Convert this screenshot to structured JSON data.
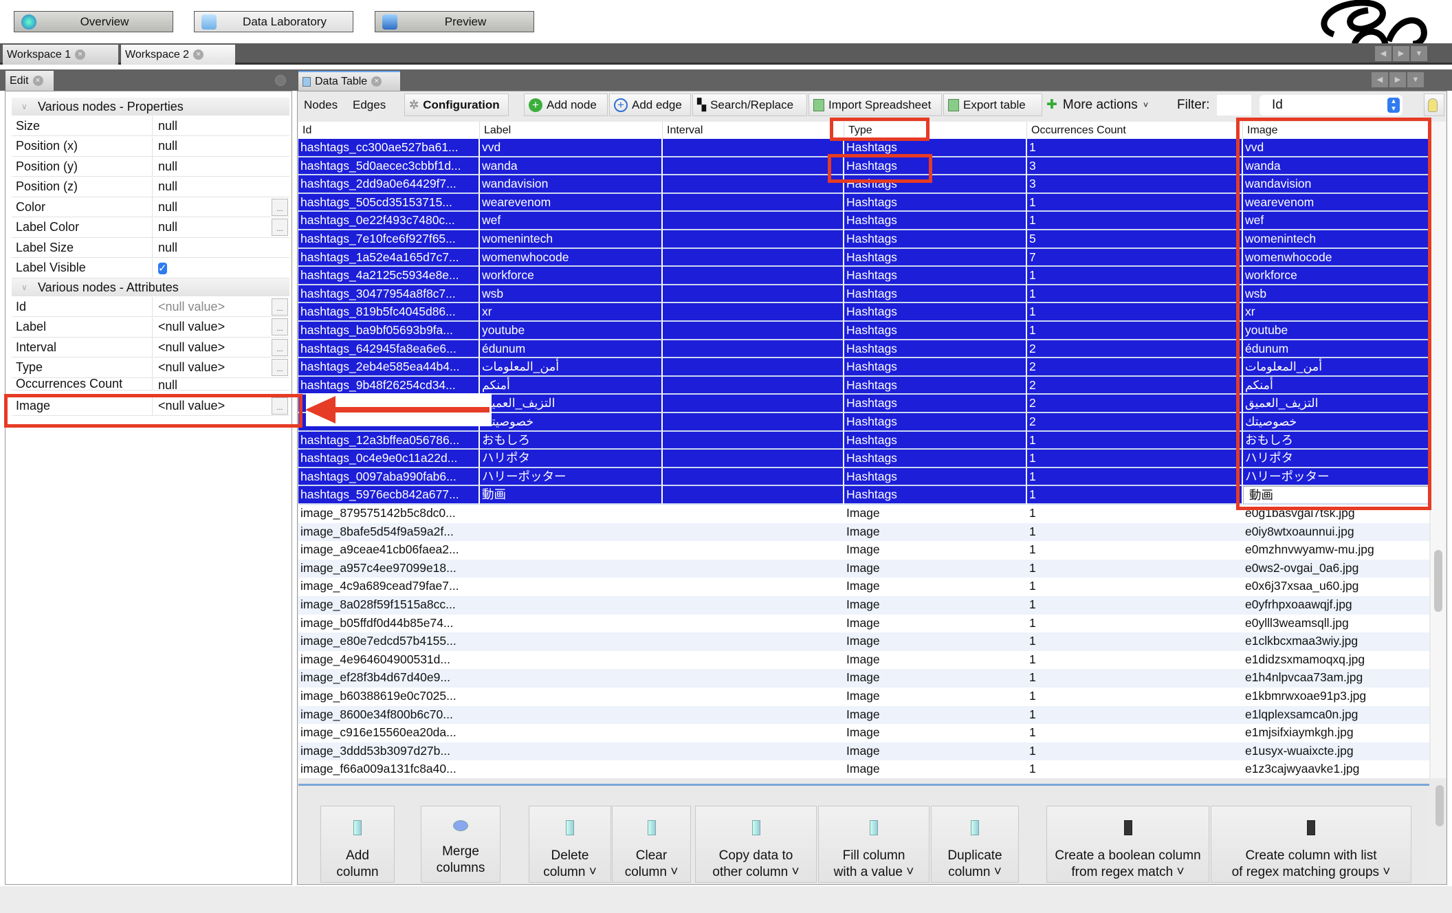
{
  "top_nav": {
    "overview": "Overview",
    "data_laboratory": "Data Laboratory",
    "preview": "Preview"
  },
  "workspaces": [
    "Workspace 1",
    "Workspace 2"
  ],
  "edit_panel": {
    "title": "Edit",
    "properties_header": "Various nodes - Properties",
    "properties": [
      {
        "key": "Size",
        "value": "null"
      },
      {
        "key": "Position (x)",
        "value": "null"
      },
      {
        "key": "Position (y)",
        "value": "null"
      },
      {
        "key": "Position (z)",
        "value": "null"
      },
      {
        "key": "Color",
        "value": "null",
        "button": "..."
      },
      {
        "key": "Label Color",
        "value": "null",
        "button": "..."
      },
      {
        "key": "Label Size",
        "value": "null"
      },
      {
        "key": "Label Visible",
        "checked": true
      }
    ],
    "attributes_header": "Various nodes - Attributes",
    "attributes": [
      {
        "key": "Id",
        "value": "<null value>",
        "button": "..."
      },
      {
        "key": "Label",
        "value": "<null value>",
        "button": "..."
      },
      {
        "key": "Interval",
        "value": "<null value>",
        "button": "..."
      },
      {
        "key": "Type",
        "value": "<null value>",
        "button": "..."
      },
      {
        "key": "Occurrences Count",
        "value": "null"
      },
      {
        "key": "Image",
        "value": "<null value>",
        "button": "..."
      }
    ]
  },
  "data_table": {
    "title": "Data Table",
    "toolbar": {
      "nodes": "Nodes",
      "edges": "Edges",
      "configuration": "Configuration",
      "add_node": "Add node",
      "add_edge": "Add edge",
      "search_replace": "Search/Replace",
      "import_spreadsheet": "Import Spreadsheet",
      "export_table": "Export table",
      "more_actions": "More actions",
      "filter_label": "Filter:",
      "filter_value": "",
      "filter_column": "Id"
    },
    "columns": [
      "Id",
      "Label",
      "Interval",
      "Type",
      "Occurrences Count",
      "Image"
    ],
    "selected_rows": 20,
    "rows": [
      [
        "hashtags_cc300ae527ba61...",
        "vvd",
        "",
        "Hashtags",
        "1",
        "vvd"
      ],
      [
        "hashtags_5d0aecec3cbbf1d...",
        "wanda",
        "",
        "Hashtags",
        "3",
        "wanda"
      ],
      [
        "hashtags_2dd9a0e64429f7...",
        "wandavision",
        "",
        "Hashtags",
        "3",
        "wandavision"
      ],
      [
        "hashtags_505cd35153715...",
        "wearevenom",
        "",
        "Hashtags",
        "1",
        "wearevenom"
      ],
      [
        "hashtags_0e22f493c7480c...",
        "wef",
        "",
        "Hashtags",
        "1",
        "wef"
      ],
      [
        "hashtags_7e10fce6f927f65...",
        "womenintech",
        "",
        "Hashtags",
        "5",
        "womenintech"
      ],
      [
        "hashtags_1a52e4a165d7c7...",
        "womenwhocode",
        "",
        "Hashtags",
        "7",
        "womenwhocode"
      ],
      [
        "hashtags_4a2125c5934e8e...",
        "workforce",
        "",
        "Hashtags",
        "1",
        "workforce"
      ],
      [
        "hashtags_30477954a8f8c7...",
        "wsb",
        "",
        "Hashtags",
        "1",
        "wsb"
      ],
      [
        "hashtags_819b5fc4045d86...",
        "xr",
        "",
        "Hashtags",
        "1",
        "xr"
      ],
      [
        "hashtags_ba9bf05693b9fa...",
        "youtube",
        "",
        "Hashtags",
        "1",
        "youtube"
      ],
      [
        "hashtags_642945fa8ea6e6...",
        "édunum",
        "",
        "Hashtags",
        "2",
        "édunum"
      ],
      [
        "hashtags_2eb4e585ea44b4...",
        "أمن_المعلومات",
        "",
        "Hashtags",
        "2",
        "أمن_المعلومات"
      ],
      [
        "hashtags_9b48f26254cd34...",
        "أمنكم",
        "",
        "Hashtags",
        "2",
        "أمنكم"
      ],
      [
        "",
        "التزيف_العميق",
        "",
        "Hashtags",
        "2",
        "التزيف_العميق"
      ],
      [
        "",
        "خصوصيتك",
        "",
        "Hashtags",
        "2",
        "خصوصيتك"
      ],
      [
        "hashtags_12a3bffea056786...",
        "おもしろ",
        "",
        "Hashtags",
        "1",
        "おもしろ"
      ],
      [
        "hashtags_0c4e9e0c11a22d...",
        "ハリポタ",
        "",
        "Hashtags",
        "1",
        "ハリポタ"
      ],
      [
        "hashtags_0097aba990fab6...",
        "ハリーポッター",
        "",
        "Hashtags",
        "1",
        "ハリーポッター"
      ],
      [
        "hashtags_5976ecb842a677...",
        "動画",
        "",
        "Hashtags",
        "1",
        "動画"
      ],
      [
        "image_879575142b5c8dc0...",
        "",
        "",
        "Image",
        "1",
        "e0g1basvgai7tsk.jpg"
      ],
      [
        "image_8bafe5d54f9a59a2f...",
        "",
        "",
        "Image",
        "1",
        "e0iy8wtxoaunnui.jpg"
      ],
      [
        "image_a9ceae41cb06faea2...",
        "",
        "",
        "Image",
        "1",
        "e0mzhnvwyamw-mu.jpg"
      ],
      [
        "image_a957c4ee97099e18...",
        "",
        "",
        "Image",
        "1",
        "e0ws2-ovgai_0a6.jpg"
      ],
      [
        "image_4c9a689cead79fae7...",
        "",
        "",
        "Image",
        "1",
        "e0x6j37xsaa_u60.jpg"
      ],
      [
        "image_8a028f59f1515a8cc...",
        "",
        "",
        "Image",
        "1",
        "e0yfrhpxoaawqjf.jpg"
      ],
      [
        "image_b05ffdf0d44b85e74...",
        "",
        "",
        "Image",
        "1",
        "e0ylll3weamsqll.jpg"
      ],
      [
        "image_e80e7edcd57b4155...",
        "",
        "",
        "Image",
        "1",
        "e1clkbcxmaa3wiy.jpg"
      ],
      [
        "image_4e964604900531d...",
        "",
        "",
        "Image",
        "1",
        "e1didzsxmamoqxq.jpg"
      ],
      [
        "image_ef28f3b4d67d40e9...",
        "",
        "",
        "Image",
        "1",
        "e1h4nlpvcaa73am.jpg"
      ],
      [
        "image_b60388619e0c7025...",
        "",
        "",
        "Image",
        "1",
        "e1kbmrwxoae91p3.jpg"
      ],
      [
        "image_8600e34f800b6c70...",
        "",
        "",
        "Image",
        "1",
        "e1lqplexsamca0n.jpg"
      ],
      [
        "image_c916e15560ea20da...",
        "",
        "",
        "Image",
        "1",
        "e1mjsifxiaymkgh.jpg"
      ],
      [
        "image_3ddd53b3097d27b...",
        "",
        "",
        "Image",
        "1",
        "e1usyx-wuaixcte.jpg"
      ],
      [
        "image_f66a009a131fc8a40...",
        "",
        "",
        "Image",
        "1",
        "e1z3cajwyaavke1.jpg"
      ]
    ]
  },
  "column_actions": [
    "Add\ncolumn",
    "Merge\ncolumns",
    "Delete\ncolumn ˅",
    "Clear\ncolumn ˅",
    "Copy data to\nother column ˅",
    "Fill column\nwith a value ˅",
    "Duplicate\ncolumn ˅",
    "Create a boolean column\nfrom regex match ˅",
    "Create column with list\nof regex matching groups ˅"
  ],
  "colors": {
    "selection": "#1c1ed8",
    "annotation": "#e63b24",
    "chrome_dark": "#5b5b5b"
  },
  "logo_text": "G"
}
